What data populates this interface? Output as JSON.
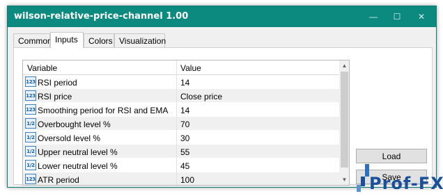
{
  "window": {
    "title": "wilson-relative-price-channel 1.00",
    "minimize_glyph": "—",
    "maximize_glyph": "☐",
    "close_glyph": "✕"
  },
  "tabs": [
    {
      "label": "Common",
      "active": false
    },
    {
      "label": "Inputs",
      "active": true
    },
    {
      "label": "Colors",
      "active": false
    },
    {
      "label": "Visualization",
      "active": false
    }
  ],
  "grid": {
    "headers": {
      "variable": "Variable",
      "value": "Value"
    },
    "rows": [
      {
        "icon": "integer-icon",
        "icon_text": "123",
        "variable": "RSI period",
        "value": "14"
      },
      {
        "icon": "integer-icon",
        "icon_text": "123",
        "variable": "RSI price",
        "value": "Close price"
      },
      {
        "icon": "integer-icon",
        "icon_text": "123",
        "variable": "Smoothing period for RSI and EMA",
        "value": "14"
      },
      {
        "icon": "double-icon",
        "icon_text": "1/2",
        "variable": "Overbought level %",
        "value": "70"
      },
      {
        "icon": "double-icon",
        "icon_text": "1/2",
        "variable": "Oversold level %",
        "value": "30"
      },
      {
        "icon": "double-icon",
        "icon_text": "1/2",
        "variable": "Upper neutral level %",
        "value": "55"
      },
      {
        "icon": "double-icon",
        "icon_text": "1/2",
        "variable": "Lower neutral level %",
        "value": "45"
      },
      {
        "icon": "integer-icon",
        "icon_text": "123",
        "variable": "ATR period",
        "value": "100"
      }
    ]
  },
  "buttons": {
    "load": "Load",
    "save": "Save"
  },
  "watermark": {
    "text": "Prof-FX"
  },
  "colors": {
    "titlebar": "#0d8a80",
    "watermark": "#1a4f9a"
  }
}
